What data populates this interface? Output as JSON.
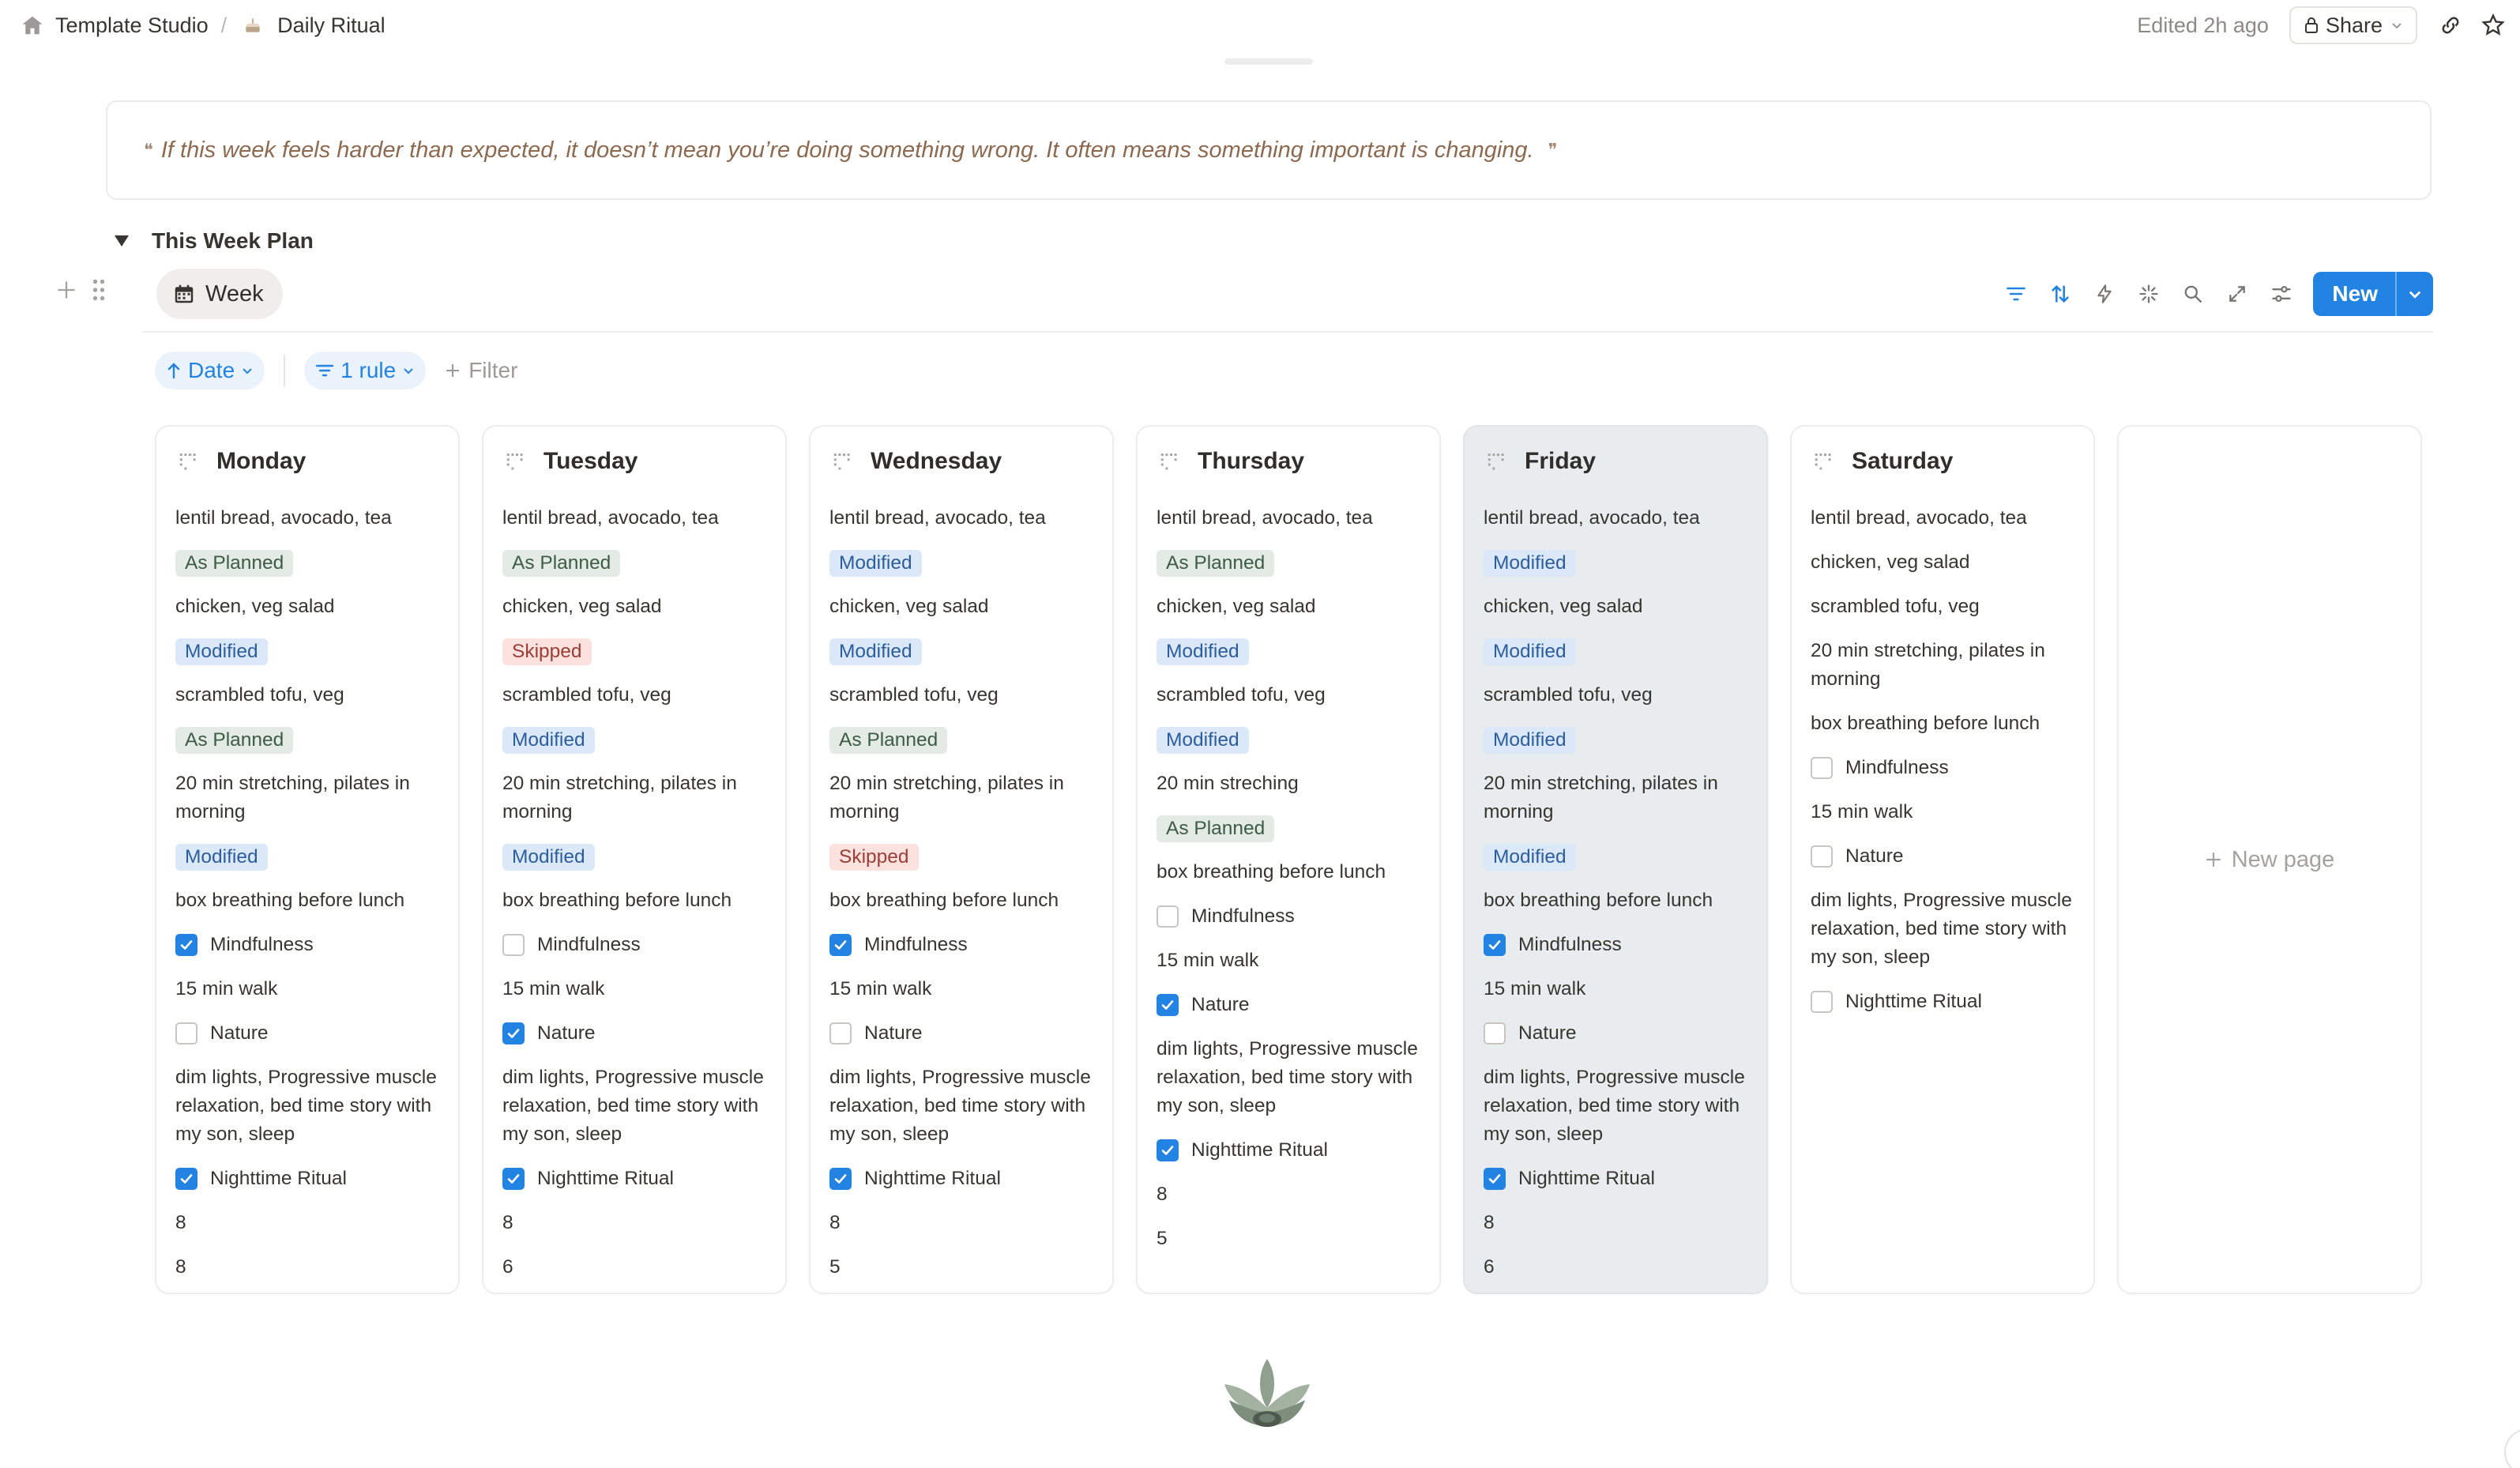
{
  "topbar": {
    "workspace": "Template Studio",
    "page": "Daily Ritual",
    "edited": "Edited 2h ago",
    "share": "Share"
  },
  "quote": "If this week feels harder than expected, it doesn’t mean you’re doing something wrong. It often means something important is changing.",
  "section": {
    "title": "This Week Plan"
  },
  "view": {
    "tab": "Week",
    "new_label": "New"
  },
  "filters": {
    "sort": "Date",
    "rule": "1 rule",
    "add": "Filter"
  },
  "board": {
    "new_page": "New page",
    "columns": [
      {
        "name": "Monday",
        "items": [
          {
            "k": "text",
            "v": "lentil bread, avocado, tea"
          },
          {
            "k": "tag",
            "v": "As Planned",
            "c": "green"
          },
          {
            "k": "text",
            "v": "chicken, veg salad"
          },
          {
            "k": "tag",
            "v": "Modified",
            "c": "blue"
          },
          {
            "k": "text",
            "v": "scrambled tofu, veg"
          },
          {
            "k": "tag",
            "v": "As Planned",
            "c": "green"
          },
          {
            "k": "text",
            "v": "20 min stretching, pilates in morning"
          },
          {
            "k": "tag",
            "v": "Modified",
            "c": "blue"
          },
          {
            "k": "text",
            "v": "box breathing before lunch"
          },
          {
            "k": "check",
            "v": "Mindfulness",
            "on": true
          },
          {
            "k": "text",
            "v": "15 min walk"
          },
          {
            "k": "check",
            "v": "Nature",
            "on": false
          },
          {
            "k": "text",
            "v": "dim lights, Progressive muscle relaxation, bed time story with my son, sleep"
          },
          {
            "k": "check",
            "v": "Nighttime Ritual",
            "on": true
          },
          {
            "k": "text",
            "v": "8"
          },
          {
            "k": "text",
            "v": "8"
          }
        ]
      },
      {
        "name": "Tuesday",
        "items": [
          {
            "k": "text",
            "v": "lentil bread, avocado, tea"
          },
          {
            "k": "tag",
            "v": "As Planned",
            "c": "green"
          },
          {
            "k": "text",
            "v": "chicken, veg salad"
          },
          {
            "k": "tag",
            "v": "Skipped",
            "c": "red"
          },
          {
            "k": "text",
            "v": "scrambled tofu, veg"
          },
          {
            "k": "tag",
            "v": "Modified",
            "c": "blue"
          },
          {
            "k": "text",
            "v": "20 min stretching, pilates in morning"
          },
          {
            "k": "tag",
            "v": "Modified",
            "c": "blue"
          },
          {
            "k": "text",
            "v": "box breathing before lunch"
          },
          {
            "k": "check",
            "v": "Mindfulness",
            "on": false
          },
          {
            "k": "text",
            "v": "15 min walk"
          },
          {
            "k": "check",
            "v": "Nature",
            "on": true
          },
          {
            "k": "text",
            "v": "dim lights, Progressive muscle relaxation, bed time story with my son, sleep"
          },
          {
            "k": "check",
            "v": "Nighttime Ritual",
            "on": true
          },
          {
            "k": "text",
            "v": "8"
          },
          {
            "k": "text",
            "v": "6"
          }
        ]
      },
      {
        "name": "Wednesday",
        "items": [
          {
            "k": "text",
            "v": "lentil bread, avocado, tea"
          },
          {
            "k": "tag",
            "v": "Modified",
            "c": "blue"
          },
          {
            "k": "text",
            "v": "chicken, veg salad"
          },
          {
            "k": "tag",
            "v": "Modified",
            "c": "blue"
          },
          {
            "k": "text",
            "v": "scrambled tofu, veg"
          },
          {
            "k": "tag",
            "v": "As Planned",
            "c": "green"
          },
          {
            "k": "text",
            "v": "20 min stretching, pilates in morning"
          },
          {
            "k": "tag",
            "v": "Skipped",
            "c": "red"
          },
          {
            "k": "text",
            "v": "box breathing before lunch"
          },
          {
            "k": "check",
            "v": "Mindfulness",
            "on": true
          },
          {
            "k": "text",
            "v": "15 min walk"
          },
          {
            "k": "check",
            "v": "Nature",
            "on": false
          },
          {
            "k": "text",
            "v": "dim lights, Progressive muscle relaxation, bed time story with my son, sleep"
          },
          {
            "k": "check",
            "v": "Nighttime Ritual",
            "on": true
          },
          {
            "k": "text",
            "v": "8"
          },
          {
            "k": "text",
            "v": "5"
          }
        ]
      },
      {
        "name": "Thursday",
        "items": [
          {
            "k": "text",
            "v": "lentil bread, avocado, tea"
          },
          {
            "k": "tag",
            "v": "As Planned",
            "c": "green"
          },
          {
            "k": "text",
            "v": "chicken, veg salad"
          },
          {
            "k": "tag",
            "v": "Modified",
            "c": "blue"
          },
          {
            "k": "text",
            "v": "scrambled tofu, veg"
          },
          {
            "k": "tag",
            "v": "Modified",
            "c": "blue"
          },
          {
            "k": "text",
            "v": "20 min streching"
          },
          {
            "k": "tag",
            "v": "As Planned",
            "c": "green"
          },
          {
            "k": "text",
            "v": "box breathing before lunch"
          },
          {
            "k": "check",
            "v": "Mindfulness",
            "on": false
          },
          {
            "k": "text",
            "v": "15 min walk"
          },
          {
            "k": "check",
            "v": "Nature",
            "on": true
          },
          {
            "k": "text",
            "v": "dim lights, Progressive muscle relaxation, bed time story with my son, sleep"
          },
          {
            "k": "check",
            "v": "Nighttime Ritual",
            "on": true
          },
          {
            "k": "text",
            "v": "8"
          },
          {
            "k": "text",
            "v": "5"
          }
        ]
      },
      {
        "name": "Friday",
        "highlight": true,
        "items": [
          {
            "k": "text",
            "v": "lentil bread, avocado, tea"
          },
          {
            "k": "tag",
            "v": "Modified",
            "c": "blue"
          },
          {
            "k": "text",
            "v": "chicken, veg salad"
          },
          {
            "k": "tag",
            "v": "Modified",
            "c": "blue"
          },
          {
            "k": "text",
            "v": "scrambled tofu, veg"
          },
          {
            "k": "tag",
            "v": "Modified",
            "c": "blue"
          },
          {
            "k": "text",
            "v": "20 min stretching, pilates in morning"
          },
          {
            "k": "tag",
            "v": "Modified",
            "c": "blue"
          },
          {
            "k": "text",
            "v": "box breathing before lunch"
          },
          {
            "k": "check",
            "v": "Mindfulness",
            "on": true
          },
          {
            "k": "text",
            "v": "15 min walk"
          },
          {
            "k": "check",
            "v": "Nature",
            "on": false
          },
          {
            "k": "text",
            "v": "dim lights, Progressive muscle relaxation, bed time story with my son, sleep"
          },
          {
            "k": "check",
            "v": "Nighttime Ritual",
            "on": true
          },
          {
            "k": "text",
            "v": "8"
          },
          {
            "k": "text",
            "v": "6"
          }
        ]
      },
      {
        "name": "Saturday",
        "items": [
          {
            "k": "text",
            "v": "lentil bread, avocado, tea"
          },
          {
            "k": "text",
            "v": "chicken, veg salad"
          },
          {
            "k": "text",
            "v": "scrambled tofu, veg"
          },
          {
            "k": "text",
            "v": "20 min stretching, pilates in morning"
          },
          {
            "k": "text",
            "v": "box breathing before lunch"
          },
          {
            "k": "check",
            "v": "Mindfulness",
            "on": false
          },
          {
            "k": "text",
            "v": "15 min walk"
          },
          {
            "k": "check",
            "v": "Nature",
            "on": false
          },
          {
            "k": "text",
            "v": "dim lights, Progressive muscle relaxation, bed time story with my son, sleep"
          },
          {
            "k": "check",
            "v": "Nighttime Ritual",
            "on": false
          }
        ]
      }
    ]
  },
  "colors": {
    "accent": "#2383e2",
    "quote": "#8d6a4f",
    "highlight_col": "#e9ecef"
  }
}
